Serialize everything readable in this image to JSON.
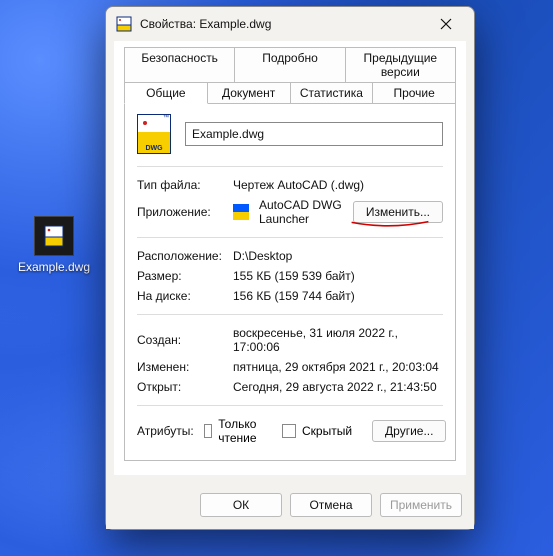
{
  "desktop": {
    "file_label": "Example.dwg"
  },
  "dialog": {
    "title": "Свойства: Example.dwg",
    "tabs_row1": [
      "Безопасность",
      "Подробно",
      "Предыдущие версии"
    ],
    "tabs_row2": [
      "Общие",
      "Документ",
      "Статистика",
      "Прочие"
    ],
    "active_tab": "Общие",
    "filename": "Example.dwg",
    "filetype_label": "Тип файла:",
    "filetype_value": "Чертеж AutoCAD (.dwg)",
    "app_label": "Приложение:",
    "app_value": "AutoCAD DWG Launcher",
    "change_button": "Изменить...",
    "location_label": "Расположение:",
    "location_value": "D:\\Desktop",
    "size_label": "Размер:",
    "size_value": "155 КБ (159 539 байт)",
    "size_on_disk_label": "На диске:",
    "size_on_disk_value": "156 КБ (159 744 байт)",
    "created_label": "Создан:",
    "created_value": "воскресенье, 31 июля 2022 г., 17:00:06",
    "modified_label": "Изменен:",
    "modified_value": "пятница, 29 октября 2021 г., 20:03:04",
    "accessed_label": "Открыт:",
    "accessed_value": "Сегодня, 29 августа 2022 г., 21:43:50",
    "attributes_label": "Атрибуты:",
    "readonly_label": "Только чтение",
    "hidden_label": "Скрытый",
    "other_button": "Другие...",
    "ok_button": "ОК",
    "cancel_button": "Отмена",
    "apply_button": "Применить",
    "dwg_badge": "DWG"
  }
}
